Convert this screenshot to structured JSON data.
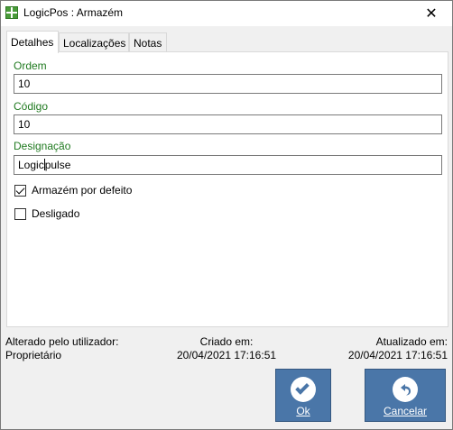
{
  "window": {
    "title": "LogicPos : Armazém",
    "close_glyph": "✕"
  },
  "tabs": [
    {
      "label": "Detalhes",
      "active": true
    },
    {
      "label": "Localizações",
      "active": false
    },
    {
      "label": "Notas",
      "active": false
    }
  ],
  "form": {
    "ordem": {
      "label": "Ordem",
      "value": "10"
    },
    "codigo": {
      "label": "Código",
      "value": "10"
    },
    "designacao": {
      "label": "Designação",
      "value_before_caret": "Logic",
      "value_after_caret": "pulse"
    },
    "default_warehouse": {
      "label": "Armazém por defeito",
      "checked": true
    },
    "disabled": {
      "label": "Desligado",
      "checked": false
    }
  },
  "footer": {
    "changed_by_label": "Alterado pelo utilizador:",
    "changed_by_value": "Proprietário",
    "created_label": "Criado em:",
    "created_value": "20/04/2021 17:16:51",
    "updated_label": "Atualizado em:",
    "updated_value": "20/04/2021 17:16:51"
  },
  "buttons": {
    "ok_label": "Ok",
    "cancel_label": "Cancelar"
  },
  "colors": {
    "label_green": "#207a20",
    "button_blue": "#4a76a8",
    "app_icon_green": "#4a9b3a"
  },
  "icons": {
    "app": "grid-window-icon",
    "close": "close-icon",
    "ok": "checkmark-icon",
    "cancel": "undo-arrow-icon"
  }
}
